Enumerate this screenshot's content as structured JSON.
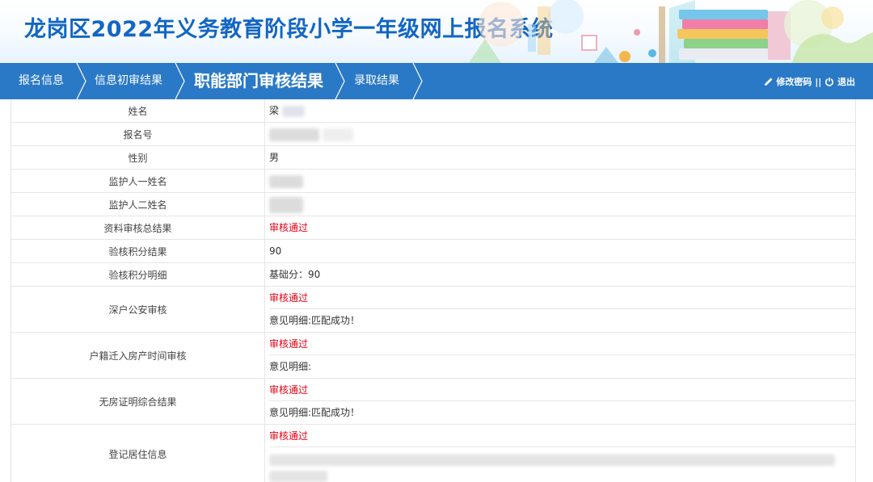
{
  "header": {
    "title": "龙岗区2022年义务教育阶段小学一年级网上报名系统"
  },
  "nav": {
    "items": [
      {
        "label": "报名信息"
      },
      {
        "label": "信息初审结果"
      },
      {
        "label": "职能部门审核结果"
      },
      {
        "label": "录取结果"
      }
    ],
    "active_index": 2,
    "change_password": "修改密码",
    "divider": "||",
    "logout": "退出"
  },
  "rows": {
    "name": {
      "label": "姓名",
      "value": "梁"
    },
    "reg_no": {
      "label": "报名号"
    },
    "gender": {
      "label": "性别",
      "value": "男"
    },
    "guardian1": {
      "label": "监护人一姓名"
    },
    "guardian2": {
      "label": "监护人二姓名"
    },
    "doc_review": {
      "label": "资料审核总结果",
      "value": "审核通过"
    },
    "points_result": {
      "label": "验核积分结果",
      "value": "90"
    },
    "points_detail": {
      "label": "验核积分明细",
      "value": "基础分：90"
    },
    "police": {
      "label": "深户公安审核",
      "status": "审核通过",
      "detail": "意见明细:匹配成功！"
    },
    "hukou_time": {
      "label": "户籍迁入房产时间审核",
      "status": "审核通过",
      "detail": "意见明细:"
    },
    "no_house": {
      "label": "无房证明综合结果",
      "status": "审核通过",
      "detail": "意见明细:匹配成功！"
    },
    "residence": {
      "label": "登记居住信息",
      "status": "审核通过"
    }
  },
  "colors": {
    "brand_blue": "#1266c4",
    "nav_blue": "#2a79c7",
    "status_red": "#e60012"
  },
  "icons": {
    "edit": "pencil-icon",
    "logout": "power-icon",
    "nav_separator": "chevron-separator"
  }
}
